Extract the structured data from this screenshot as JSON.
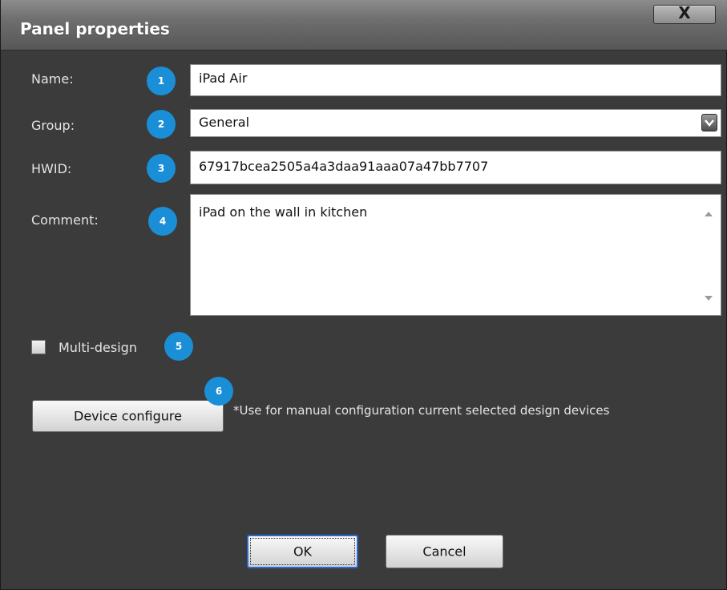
{
  "window": {
    "title": "Panel properties",
    "close_label": "X"
  },
  "form": {
    "name": {
      "label": "Name:",
      "value": "iPad Air",
      "badge": "1"
    },
    "group": {
      "label": "Group:",
      "value": "General",
      "badge": "2"
    },
    "hwid": {
      "label": "HWID:",
      "value": "67917bcea2505a4a3daa91aaa07a47bb7707",
      "badge": "3"
    },
    "comment": {
      "label": "Comment:",
      "value": "iPad on the wall in kitchen",
      "badge": "4"
    },
    "multi_design": {
      "label": "Multi-design",
      "checked": false,
      "badge": "5"
    },
    "device_configure": {
      "button_label": "Device configure",
      "badge": "6",
      "note": "*Use for manual configuration current selected design devices"
    }
  },
  "footer": {
    "ok_label": "OK",
    "cancel_label": "Cancel"
  },
  "colors": {
    "dialog_bg": "#3b3b3b",
    "badge": "#1a8fd8",
    "title_text": "#ffffff"
  },
  "icons": {
    "close": "close-icon",
    "dropdown": "chevron-down-icon",
    "scroll_up": "scroll-up-arrow-icon",
    "scroll_down": "scroll-down-arrow-icon"
  }
}
